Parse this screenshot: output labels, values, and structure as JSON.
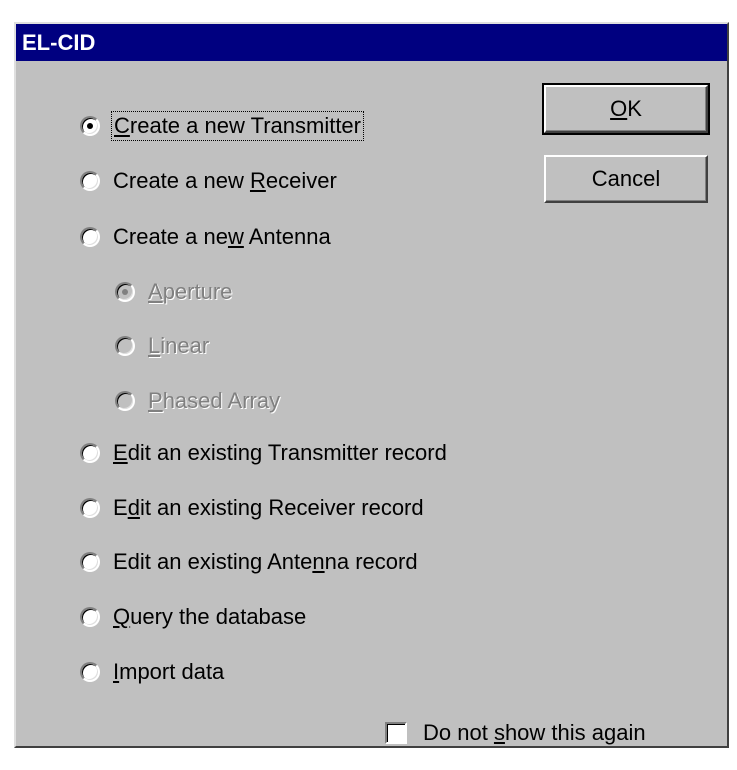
{
  "window": {
    "title": "EL-CID"
  },
  "buttons": {
    "ok_pre": "",
    "ok_ul": "O",
    "ok_post": "K",
    "cancel": "Cancel"
  },
  "options": [
    {
      "pre": "",
      "ul": "C",
      "post": "reate a new Transmitter",
      "selected": true,
      "disabled": false
    },
    {
      "pre": "Create a new ",
      "ul": "R",
      "post": "eceiver",
      "selected": false,
      "disabled": false
    },
    {
      "pre": "Create a ne",
      "ul": "w",
      "post": " Antenna",
      "selected": false,
      "disabled": false
    },
    {
      "pre": "",
      "ul": "A",
      "post": "perture",
      "selected": true,
      "disabled": true
    },
    {
      "pre": "",
      "ul": "L",
      "post": "inear",
      "selected": false,
      "disabled": true
    },
    {
      "pre": "",
      "ul": "P",
      "post": "hased Array",
      "selected": false,
      "disabled": true
    },
    {
      "pre": "",
      "ul": "E",
      "post": "dit an existing Transmitter record",
      "selected": false,
      "disabled": false
    },
    {
      "pre": "E",
      "ul": "d",
      "post": "it an existing Receiver record",
      "selected": false,
      "disabled": false
    },
    {
      "pre": "Edit an existing Ante",
      "ul": "n",
      "post": "na record",
      "selected": false,
      "disabled": false
    },
    {
      "pre": "",
      "ul": "Q",
      "post": "uery the database",
      "selected": false,
      "disabled": false
    },
    {
      "pre": "",
      "ul": "I",
      "post": "mport data",
      "selected": false,
      "disabled": false
    }
  ],
  "checkbox": {
    "pre": "Do not ",
    "ul": "s",
    "post": "how this again",
    "checked": false
  }
}
